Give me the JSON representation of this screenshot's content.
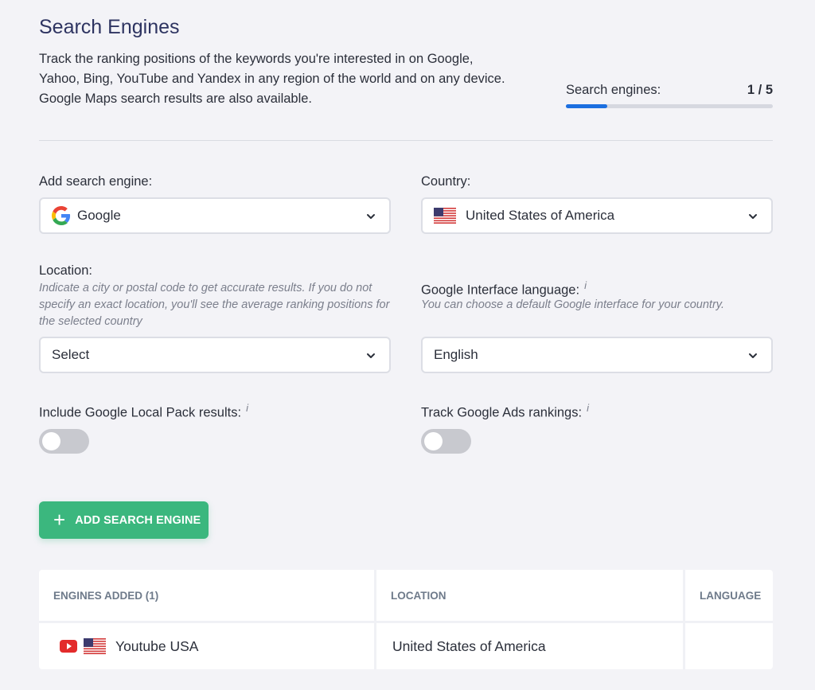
{
  "header": {
    "title": "Search Engines",
    "description": "Track the ranking positions of the keywords you're interested in on Google, Yahoo, Bing, YouTube and Yandex in any region of the world and on any device. Google Maps search results are also available.",
    "progress_label": "Search engines:",
    "progress_count": "1 / 5",
    "progress_fraction": 0.2
  },
  "form": {
    "engine": {
      "label": "Add search engine:",
      "value": "Google",
      "icon": "google-g-icon"
    },
    "country": {
      "label": "Country:",
      "value": "United States of America",
      "icon": "us-flag-icon"
    },
    "location": {
      "label": "Location:",
      "hint": "Indicate a city or postal code to get accurate results. If you do not specify an exact location, you'll see the average ranking positions for the selected country",
      "value": "Select"
    },
    "language": {
      "label": "Google Interface language:",
      "hint": "You can choose a default Google interface for your country.",
      "value": "English"
    },
    "local_pack": {
      "label": "Include Google Local Pack results:",
      "enabled": false
    },
    "ads": {
      "label": "Track Google Ads rankings:",
      "enabled": false
    },
    "info_glyph": "i",
    "add_button": "ADD SEARCH ENGINE"
  },
  "table": {
    "headers": [
      "ENGINES ADDED (1)",
      "LOCATION",
      "LANGUAGE"
    ],
    "rows": [
      {
        "engine": "Youtube USA",
        "location": "United States of America",
        "language": ""
      }
    ]
  },
  "colors": {
    "accent": "#3bb77e",
    "progress": "#1c6fe0",
    "title": "#2e3461"
  }
}
